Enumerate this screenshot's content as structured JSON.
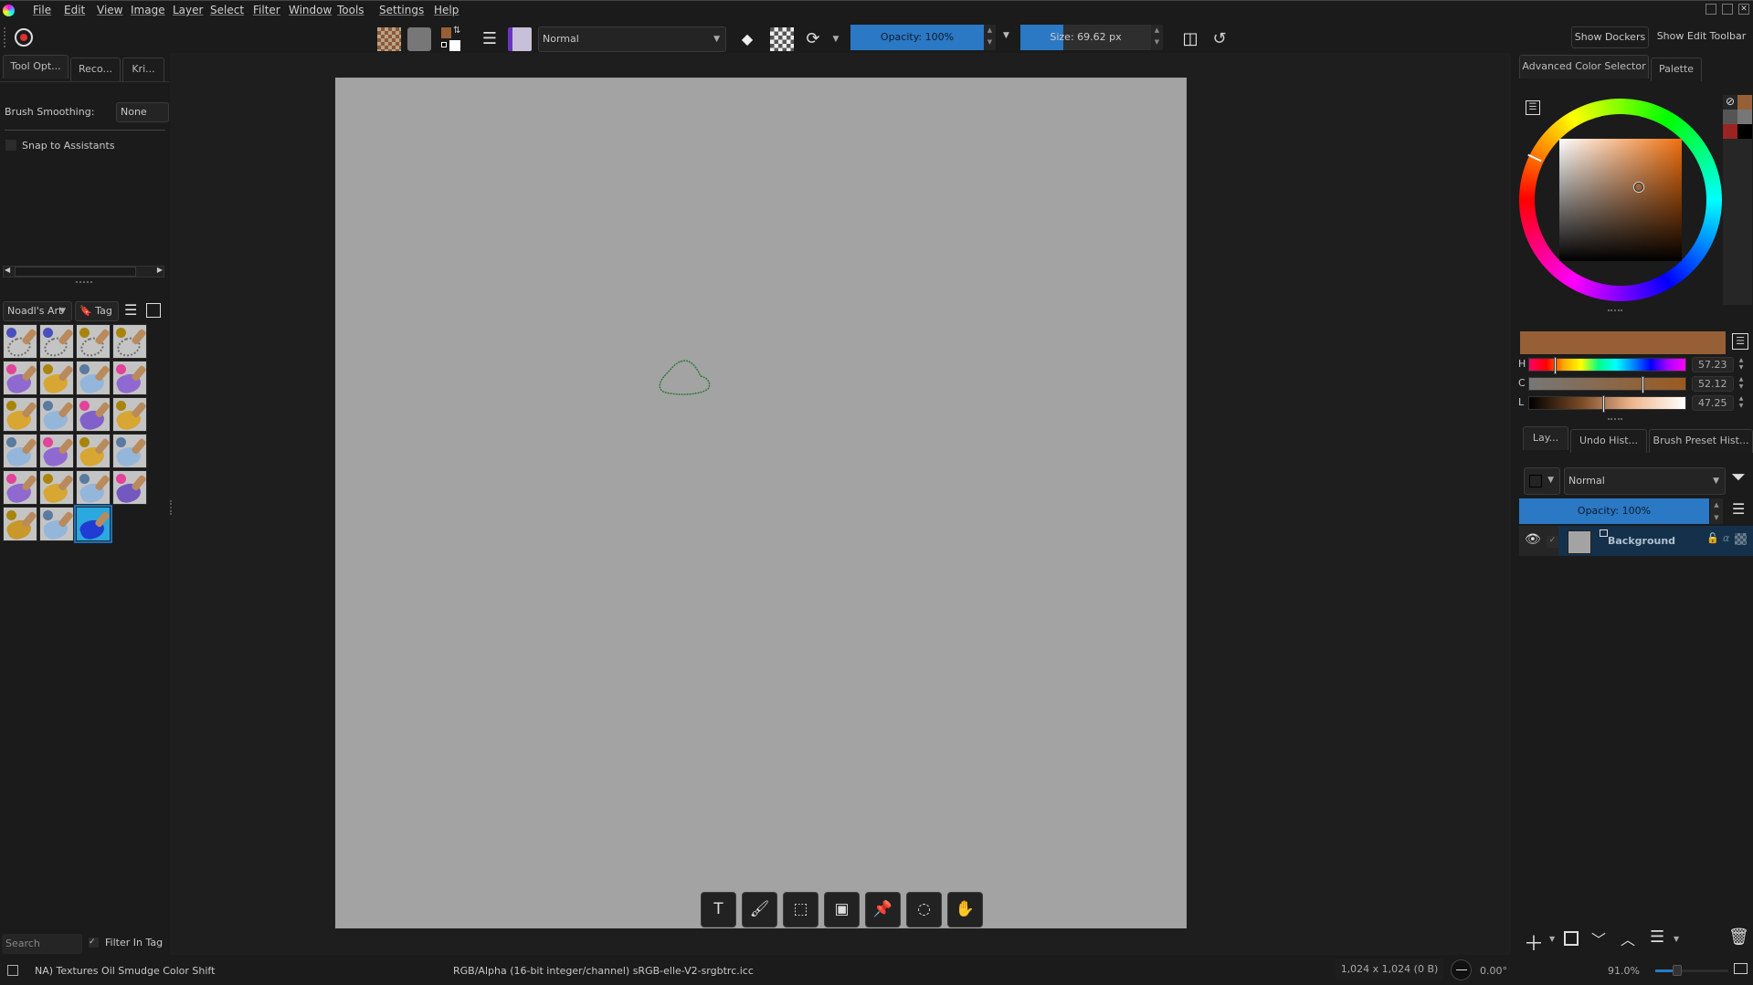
{
  "menu": [
    "File",
    "Edit",
    "View",
    "Image",
    "Layer",
    "Select",
    "Filter",
    "Window",
    "Tools",
    "Settings",
    "Help"
  ],
  "toolbar": {
    "blend_mode": "Normal",
    "opacity": "Opacity: 100%",
    "opacity_value": 100,
    "size": "Size: 69.62 px",
    "size_fraction": 0.33,
    "show_dockers": "Show Dockers",
    "show_edit_toolbar": "Show Edit Toolbar",
    "fg_color": "#975f36",
    "bg_color": "#ffffff"
  },
  "left_panel": {
    "tabs": [
      "Tool Opt...",
      "Reco...",
      "Kri..."
    ],
    "brush_smoothing_label": "Brush Smoothing:",
    "brush_smoothing_value": "None",
    "snap_label": "Snap to Assistants",
    "snap_checked": false,
    "brush_chooser": {
      "tag_set": "Noadl's Art",
      "tag_label": "Tag",
      "search_placeholder": "Search",
      "filter_in_tag": "Filter In Tag",
      "filter_checked": true,
      "presets": [
        {
          "dot": "#4a4fc0",
          "stroke": "chain"
        },
        {
          "dot": "#4a4fc0",
          "stroke": "chain"
        },
        {
          "dot": "#a8850a",
          "stroke": "chain"
        },
        {
          "dot": "#a8850a",
          "stroke": "chain"
        },
        {
          "dot": "#e0459a",
          "stroke": "#8a5fd0"
        },
        {
          "dot": "#a8850a",
          "stroke": "#d9a324"
        },
        {
          "dot": "#5a7aa0",
          "stroke": "#8fb5dd"
        },
        {
          "dot": "#e0459a",
          "stroke": "#8a5fd0"
        },
        {
          "dot": "#a8850a",
          "stroke": "#d9a324"
        },
        {
          "dot": "#5a7aa0",
          "stroke": "#8fb5dd"
        },
        {
          "dot": "#e0459a",
          "stroke": "#7a55cc"
        },
        {
          "dot": "#a8850a",
          "stroke": "#d9a324"
        },
        {
          "dot": "#5a7aa0",
          "stroke": "#8fb5dd"
        },
        {
          "dot": "#e0459a",
          "stroke": "#8a5fd0"
        },
        {
          "dot": "#a8850a",
          "stroke": "#d9a324"
        },
        {
          "dot": "#5a7aa0",
          "stroke": "#8fb5dd"
        },
        {
          "dot": "#e0459a",
          "stroke": "#8a5fd0"
        },
        {
          "dot": "#a8850a",
          "stroke": "#d9a324"
        },
        {
          "dot": "#5a7aa0",
          "stroke": "#8fb5dd"
        },
        {
          "dot": "#e0459a",
          "stroke": "#6a4cc0"
        },
        {
          "dot": "#a8850a",
          "stroke": "#c9931a"
        },
        {
          "dot": "#5a7aa0",
          "stroke": "#8fb5dd"
        },
        {
          "dot": "",
          "stroke": "#2030d0",
          "selected": true
        }
      ]
    }
  },
  "floating_tools": [
    {
      "name": "text",
      "glyph": "T"
    },
    {
      "name": "brush",
      "glyph": "🖌"
    },
    {
      "name": "transform",
      "glyph": "⬚"
    },
    {
      "name": "gradient",
      "glyph": "▣"
    },
    {
      "name": "pin",
      "glyph": "📌"
    },
    {
      "name": "lasso",
      "glyph": "◌"
    },
    {
      "name": "pan",
      "glyph": "✋"
    }
  ],
  "right_panel": {
    "tabs": [
      "Advanced Color Selector",
      "Palette"
    ],
    "color_swatches": [
      "#975f36",
      "#555555",
      "#777777",
      "#9b2323",
      "#000000"
    ],
    "current_color": "#975f36",
    "hcl": [
      {
        "label": "H",
        "value": "57.23",
        "fraction": 0.16
      },
      {
        "label": "C",
        "value": "52.12",
        "fraction": 0.72
      },
      {
        "label": "L",
        "value": "47.25",
        "fraction": 0.47
      }
    ],
    "docker_tabs": [
      "Lay...",
      "Undo Hist...",
      "Brush Preset Hist..."
    ],
    "layer_blend": "Normal",
    "layer_opacity": "Opacity:  100%",
    "layers": [
      {
        "name": "Background",
        "visible": true,
        "checked": true
      }
    ]
  },
  "status": {
    "brush_name": "NA) Textures Oil Smudge Color Shift",
    "color_profile": "RGB/Alpha (16-bit integer/channel)  sRGB-elle-V2-srgbtrc.icc",
    "image_size": "1,024 x 1,024 (0 B)",
    "rotation": "0.00°",
    "zoom": "91.0%",
    "zoom_fraction": 0.3
  }
}
